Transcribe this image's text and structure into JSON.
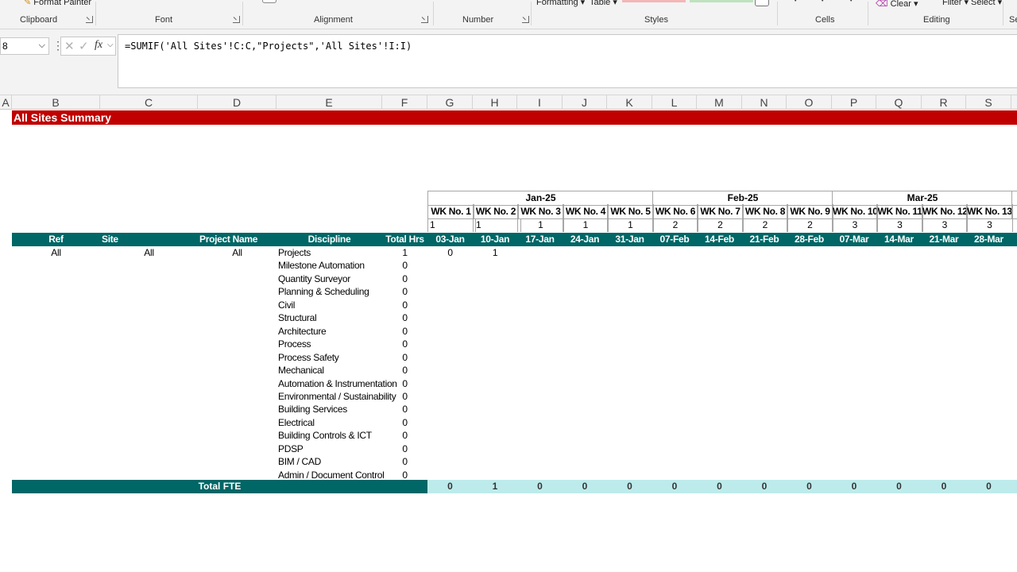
{
  "ribbon": {
    "format_painter": "Format Painter",
    "formatting": "Formatting",
    "table": "Table",
    "clear": "Clear",
    "filter": "Filter",
    "select": "Select",
    "groups": [
      "Clipboard",
      "Font",
      "Alignment",
      "Number",
      "Styles",
      "Cells",
      "Editing",
      "Se"
    ]
  },
  "formula_bar": {
    "name_box": "8",
    "formula": "=SUMIF('All Sites'!C:C,\"Projects\",'All Sites'!I:I)"
  },
  "columns": [
    "A",
    "B",
    "C",
    "D",
    "E",
    "F",
    "G",
    "H",
    "I",
    "J",
    "K",
    "L",
    "M",
    "N",
    "O",
    "P",
    "Q",
    "R",
    "S"
  ],
  "sheet": {
    "title": "All Sites Summary",
    "months": [
      "Jan-25",
      "Feb-25",
      "Mar-25"
    ],
    "weeks": [
      "WK No. 1",
      "WK No. 2",
      "WK No. 3",
      "WK No. 4",
      "WK No. 5",
      "WK No. 6",
      "WK No. 7",
      "WK No. 8",
      "WK No. 9",
      "WK No. 10",
      "WK No. 11",
      "WK No. 12",
      "WK No. 13"
    ],
    "month_nums": [
      "1",
      "1",
      "1",
      "1",
      "1",
      "2",
      "2",
      "2",
      "2",
      "3",
      "3",
      "3",
      "3"
    ],
    "headers": {
      "ref": "Ref",
      "site": "Site",
      "project": "Project Name",
      "discipline": "Discipline",
      "total": "Total Hrs"
    },
    "dates": [
      "03-Jan",
      "10-Jan",
      "17-Jan",
      "24-Jan",
      "31-Jan",
      "07-Feb",
      "14-Feb",
      "21-Feb",
      "28-Feb",
      "07-Mar",
      "14-Mar",
      "21-Mar",
      "28-Mar"
    ],
    "filters": {
      "ref": "All",
      "site": "All",
      "project": "All"
    },
    "disciplines": [
      {
        "name": "Projects",
        "total": "1",
        "w1": "0",
        "w2": "1"
      },
      {
        "name": "Milestone Automation",
        "total": "0"
      },
      {
        "name": "Quantity Surveyor",
        "total": "0"
      },
      {
        "name": "Planning & Scheduling",
        "total": "0"
      },
      {
        "name": "Civil",
        "total": "0"
      },
      {
        "name": "Structural",
        "total": "0"
      },
      {
        "name": "Architecture",
        "total": "0"
      },
      {
        "name": "Process",
        "total": "0"
      },
      {
        "name": "Process Safety",
        "total": "0"
      },
      {
        "name": "Mechanical",
        "total": "0"
      },
      {
        "name": "Automation & Instrumentation",
        "total": "0"
      },
      {
        "name": "Environmental / Sustainability",
        "total": "0"
      },
      {
        "name": "Building Services",
        "total": "0"
      },
      {
        "name": "Electrical",
        "total": "0"
      },
      {
        "name": "Building Controls & ICT",
        "total": "0"
      },
      {
        "name": "PDSP",
        "total": "0"
      },
      {
        "name": "BIM / CAD",
        "total": "0"
      },
      {
        "name": "Admin / Document Control",
        "total": "0"
      }
    ],
    "total_label": "Total FTE",
    "fte": [
      "0",
      "1",
      "0",
      "0",
      "0",
      "0",
      "0",
      "0",
      "0",
      "0",
      "0",
      "0",
      "0"
    ]
  }
}
